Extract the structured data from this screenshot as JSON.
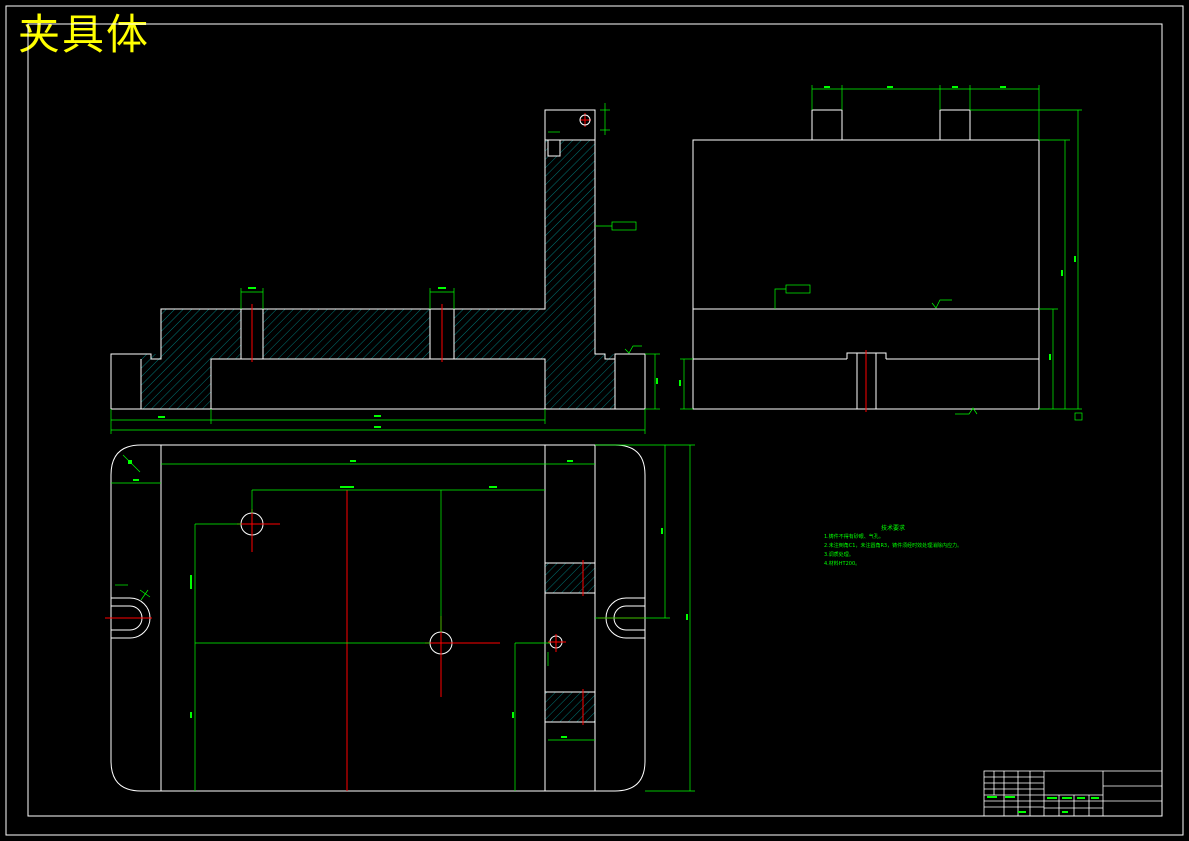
{
  "title": "夹具体",
  "colors": {
    "background": "#000000",
    "outline": "#ffffff",
    "dimension": "#00ff00",
    "centerline": "#ff0000",
    "title": "#ffff00",
    "hatch": "#00c8c8"
  },
  "notes": {
    "heading": "技术要求",
    "lines": [
      "1.铸件不得有砂眼、气孔。",
      "2.未注倒角C1，未注圆角R3，铸件须经时效处理消除内应力。",
      "3.调质处理。",
      "4.材料HT200。"
    ]
  }
}
